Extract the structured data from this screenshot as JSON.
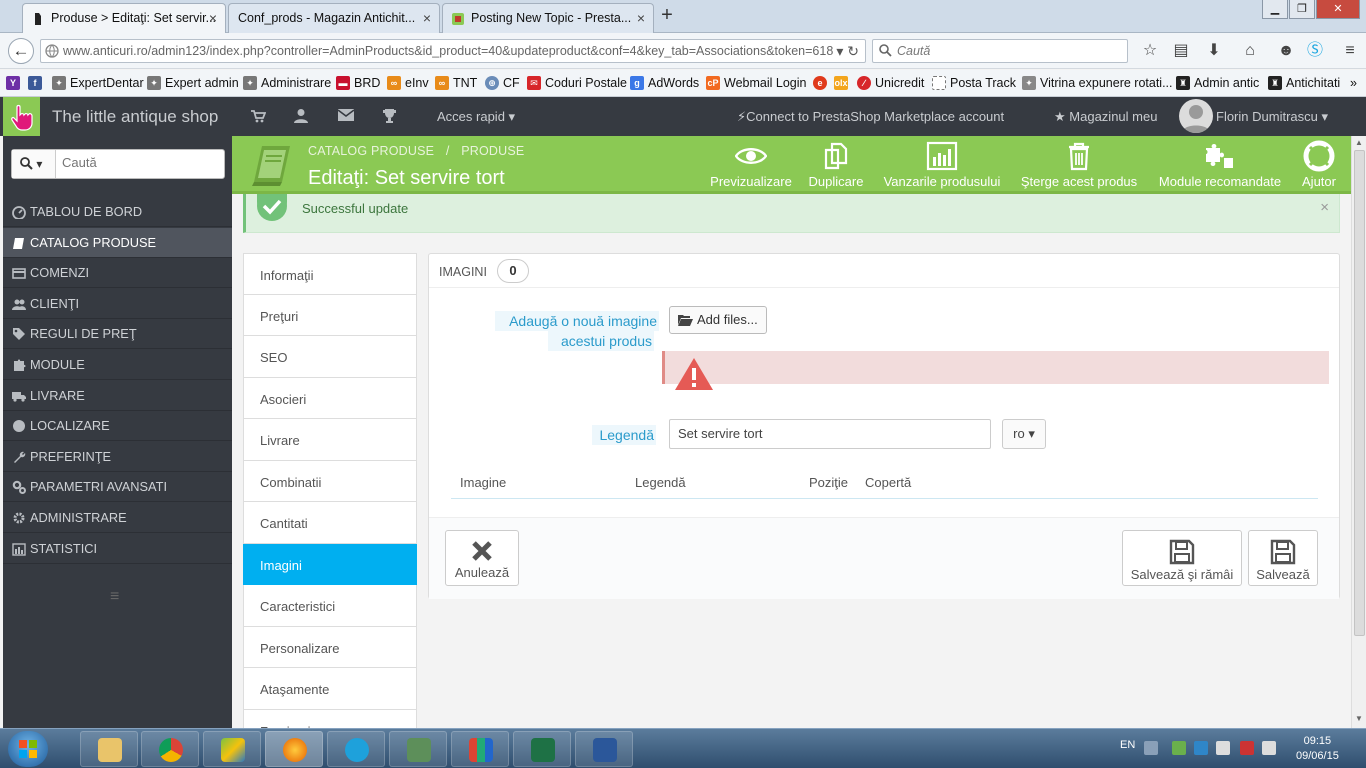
{
  "browser": {
    "tabs": [
      {
        "title": "Produse > Editaţi: Set servir...",
        "active": true
      },
      {
        "title": "Conf_prods - Magazin Antichit...",
        "active": false
      },
      {
        "title": "Posting New Topic - Presta...",
        "active": false
      }
    ],
    "tab_close": "×",
    "new_tab": "+",
    "window_buttons": {
      "minimize": "▁",
      "maximize": "❐",
      "close": "✕"
    },
    "url": "www.anticuri.ro/admin123/index.php?controller=AdminProducts&id_product=40&updateproduct&conf=4&key_tab=Associations&token=618",
    "search_placeholder": "Caută",
    "bookmarks": [
      "ExpertDentar",
      "Expert admin",
      "Administrare",
      "BRD",
      "eInv",
      "TNT",
      "CF",
      "Coduri Postale",
      "AdWords",
      "Webmail Login",
      "Unicredit",
      "Posta Track",
      "Vitrina expunere rotati...",
      "Admin antic",
      "Antichitati"
    ],
    "bookmark_more": "»"
  },
  "header": {
    "shop_name": "The little antique shop",
    "quick_access": "Acces rapid",
    "marketplace": "Connect to PrestaShop Marketplace account",
    "my_shop": "Magazinul meu",
    "user_name": "Florin Dumitrascu"
  },
  "sidebar": {
    "search_placeholder": "Caută",
    "items": [
      {
        "label": "TABLOU DE BORD",
        "icon": "dashboard-icon",
        "active": false
      },
      {
        "label": "CATALOG PRODUSE",
        "icon": "book-icon",
        "active": true
      },
      {
        "label": "COMENZI",
        "icon": "credit-card-icon",
        "active": false
      },
      {
        "label": "CLIENŢI",
        "icon": "users-icon",
        "active": false
      },
      {
        "label": "REGULI DE PREŢ",
        "icon": "tag-icon",
        "active": false
      },
      {
        "label": "MODULE",
        "icon": "puzzle-icon",
        "active": false
      },
      {
        "label": "LIVRARE",
        "icon": "truck-icon",
        "active": false
      },
      {
        "label": "LOCALIZARE",
        "icon": "globe-icon",
        "active": false
      },
      {
        "label": "PREFERINŢE",
        "icon": "wrench-icon",
        "active": false
      },
      {
        "label": "PARAMETRI AVANSATI",
        "icon": "cogs-icon",
        "active": false
      },
      {
        "label": "ADMINISTRARE",
        "icon": "cog-icon",
        "active": false
      },
      {
        "label": "STATISTICI",
        "icon": "bar-chart-icon",
        "active": false
      }
    ]
  },
  "toolbar": {
    "breadcrumb": [
      "CATALOG PRODUSE",
      "PRODUSE"
    ],
    "breadcrumb_sep": "/",
    "title": "Editaţi: Set servire tort",
    "buttons": [
      {
        "label": "Previzualizare",
        "icon": "eye-icon"
      },
      {
        "label": "Duplicare",
        "icon": "copy-icon"
      },
      {
        "label": "Vanzarile produsului",
        "icon": "chart-icon"
      },
      {
        "label": "Şterge acest produs",
        "icon": "trash-icon"
      },
      {
        "label": "Module recomandate",
        "icon": "puzzle-icon"
      },
      {
        "label": "Ajutor",
        "icon": "lifebuoy-icon"
      }
    ]
  },
  "alert": {
    "text": "Successful update",
    "close": "×"
  },
  "product_tabs": [
    {
      "label": "Informaţii",
      "active": false
    },
    {
      "label": "Preţuri",
      "active": false
    },
    {
      "label": "SEO",
      "active": false
    },
    {
      "label": "Asocieri",
      "active": false
    },
    {
      "label": "Livrare",
      "active": false
    },
    {
      "label": "Combinatii",
      "active": false
    },
    {
      "label": "Cantitati",
      "active": false
    },
    {
      "label": "Imagini",
      "active": true
    },
    {
      "label": "Caracteristici",
      "active": false
    },
    {
      "label": "Personalizare",
      "active": false
    },
    {
      "label": "Ataşamente",
      "active": false
    },
    {
      "label": "Furnizori",
      "active": false
    }
  ],
  "panel": {
    "title": "IMAGINI",
    "count": "0",
    "add_label_line1": "Adaugă o nouă imagine",
    "add_label_line2": "acestui produs",
    "add_files": "Add files...",
    "legend_label": "Legendă",
    "legend_value": "Set servire tort",
    "language": "ro",
    "columns": [
      "Imagine",
      "Legendă",
      "Poziţie",
      "Copertă"
    ],
    "cancel": "Anulează",
    "save_stay": "Salvează şi rămâi",
    "save": "Salvează"
  },
  "taskbar": {
    "language": "EN",
    "time": "09:15",
    "date": "09/06/15"
  },
  "colors": {
    "accent_green": "#8bc954",
    "active_tab_blue": "#00aff0",
    "sidebar_dark": "#363a41"
  }
}
